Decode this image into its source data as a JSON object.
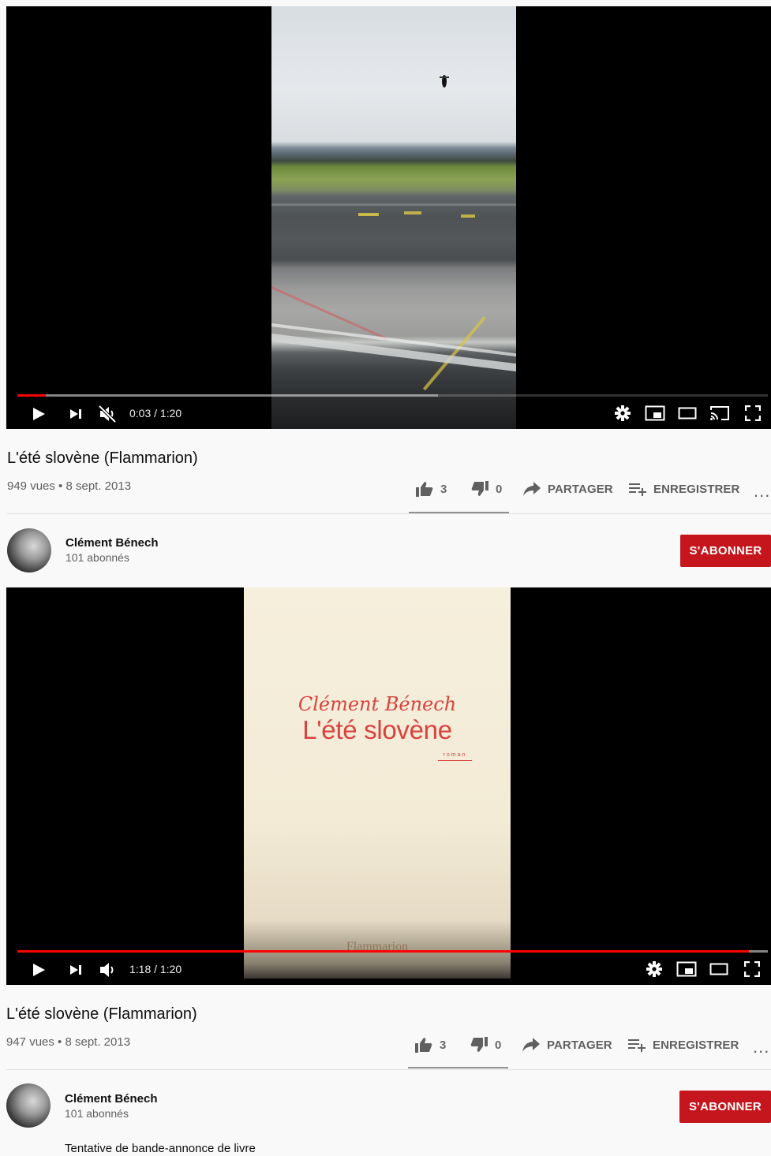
{
  "screens": [
    {
      "player": {
        "time": "0:03 / 1:20",
        "progress": 0.0375,
        "buffered": 0.56,
        "muted": true,
        "show_cast": true
      },
      "video_title": "L'été slovène (Flammarion)",
      "meta": "949 vues • 8 sept. 2013",
      "likes": "3",
      "dislikes": "0",
      "share_label": "PARTAGER",
      "save_label": "ENREGISTRER",
      "more_label": "...",
      "channel": {
        "name": "Clément Bénech",
        "subscribers": "101 abonnés"
      },
      "subscribe_label": "S'ABONNER"
    },
    {
      "player": {
        "time": "1:18 / 1:20",
        "progress": 0.975,
        "buffered": 1.0,
        "muted": false,
        "show_cast": false
      },
      "cover": {
        "author": "Clément Bénech",
        "title": "L'été slovène",
        "genre": "roman",
        "publisher": "Flammarion"
      },
      "video_title": "L'été slovène (Flammarion)",
      "meta": "947 vues • 8 sept. 2013",
      "likes": "3",
      "dislikes": "0",
      "share_label": "PARTAGER",
      "save_label": "ENREGISTRER",
      "more_label": "...",
      "channel": {
        "name": "Clément Bénech",
        "subscribers": "101 abonnés"
      },
      "subscribe_label": "S'ABONNER",
      "description": "Tentative de bande-annonce de livre"
    }
  ],
  "colors": {
    "accent": "#ff0000",
    "subscribe": "#c4161c",
    "cover_text": "#d8433f"
  },
  "icons": [
    "play-icon",
    "next-icon",
    "volume-muted-icon",
    "volume-icon",
    "settings-icon",
    "miniplayer-icon",
    "theater-icon",
    "cast-icon",
    "fullscreen-icon",
    "like-icon",
    "dislike-icon",
    "share-icon",
    "save-playlist-icon"
  ]
}
